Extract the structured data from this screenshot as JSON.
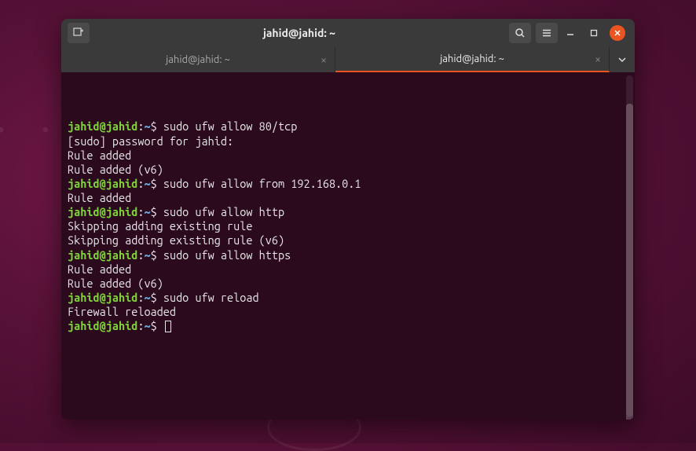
{
  "window": {
    "title": "jahid@jahid: ~"
  },
  "tabs": [
    {
      "label": "jahid@jahid: ~",
      "active": false
    },
    {
      "label": "jahid@jahid: ~",
      "active": true
    }
  ],
  "prompt": {
    "user_host": "jahid@jahid",
    "sep": ":",
    "path": "~",
    "symbol": "$"
  },
  "lines": [
    {
      "type": "cmd",
      "text": " sudo ufw allow 80/tcp"
    },
    {
      "type": "out",
      "text": "[sudo] password for jahid:"
    },
    {
      "type": "out",
      "text": "Rule added"
    },
    {
      "type": "out",
      "text": "Rule added (v6)"
    },
    {
      "type": "cmd",
      "text": " sudo ufw allow from 192.168.0.1"
    },
    {
      "type": "out",
      "text": "Rule added"
    },
    {
      "type": "cmd",
      "text": " sudo ufw allow http"
    },
    {
      "type": "out",
      "text": "Skipping adding existing rule"
    },
    {
      "type": "out",
      "text": "Skipping adding existing rule (v6)"
    },
    {
      "type": "cmd",
      "text": " sudo ufw allow https"
    },
    {
      "type": "out",
      "text": "Rule added"
    },
    {
      "type": "out",
      "text": "Rule added (v6)"
    },
    {
      "type": "cmd",
      "text": " sudo ufw reload"
    },
    {
      "type": "out",
      "text": "Firewall reloaded"
    },
    {
      "type": "cmd",
      "text": " ",
      "cursor": true
    }
  ],
  "colors": {
    "accent": "#e95420",
    "prompt_user": "#7fd13b",
    "prompt_path": "#6aa7d8",
    "terminal_bg": "#2b0a1e"
  }
}
